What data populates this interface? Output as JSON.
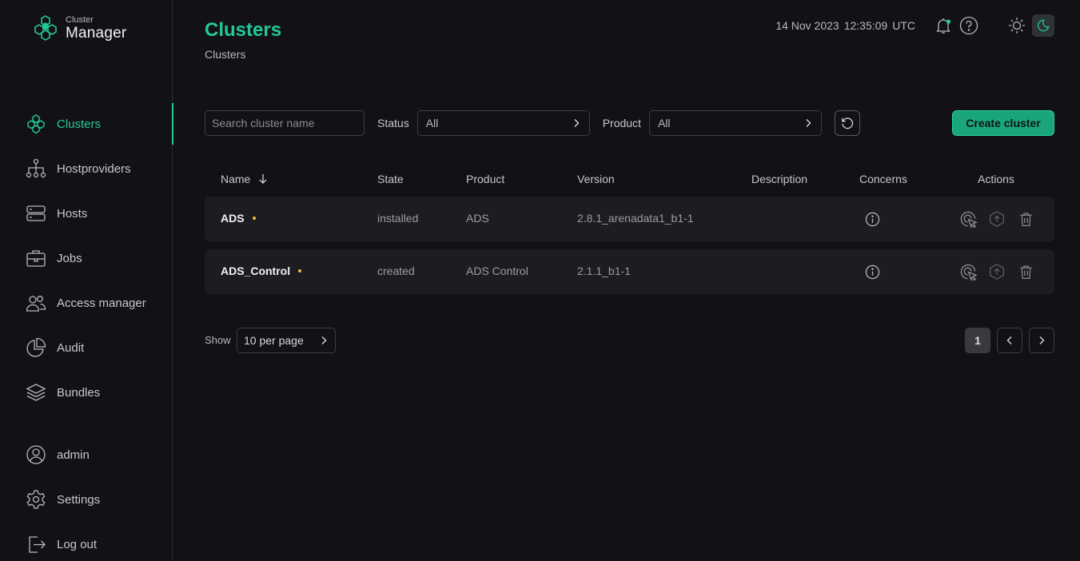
{
  "app": {
    "logo_small": "Cluster",
    "logo_big": "Manager"
  },
  "sidebar": {
    "items": [
      {
        "label": "Clusters",
        "icon": "clusters-icon",
        "active": true
      },
      {
        "label": "Hostproviders",
        "icon": "hierarchy-icon"
      },
      {
        "label": "Hosts",
        "icon": "server-icon"
      },
      {
        "label": "Jobs",
        "icon": "briefcase-icon"
      },
      {
        "label": "Access manager",
        "icon": "users-icon"
      },
      {
        "label": "Audit",
        "icon": "pie-chart-icon"
      },
      {
        "label": "Bundles",
        "icon": "layers-icon"
      }
    ],
    "bottom": [
      {
        "label": "admin",
        "icon": "user-icon"
      },
      {
        "label": "Settings",
        "icon": "gear-icon"
      },
      {
        "label": "Log out",
        "icon": "logout-icon"
      }
    ]
  },
  "header": {
    "title": "Clusters",
    "breadcrumb": "Clusters",
    "date": "14 Nov 2023",
    "time": "12:35:09",
    "tz": "UTC"
  },
  "toolbar": {
    "search_placeholder": "Search cluster name",
    "status_label": "Status",
    "status_value": "All",
    "product_label": "Product",
    "product_value": "All",
    "create_label": "Create cluster"
  },
  "table": {
    "columns": [
      "Name",
      "State",
      "Product",
      "Version",
      "Description",
      "Concerns",
      "Actions"
    ],
    "rows": [
      {
        "name": "ADS",
        "state": "installed",
        "product": "ADS",
        "version": "2.8.1_arenadata1_b1-1",
        "description": ""
      },
      {
        "name": "ADS_Control",
        "state": "created",
        "product": "ADS Control",
        "version": "2.1.1_b1-1",
        "description": ""
      }
    ]
  },
  "pagination": {
    "show_label": "Show",
    "per_page": "10 per page",
    "current_page": "1"
  },
  "colors": {
    "accent": "#23c89a",
    "warning_dot": "#f4b73a",
    "background": "#121115",
    "row_bg": "#1d1c21"
  }
}
